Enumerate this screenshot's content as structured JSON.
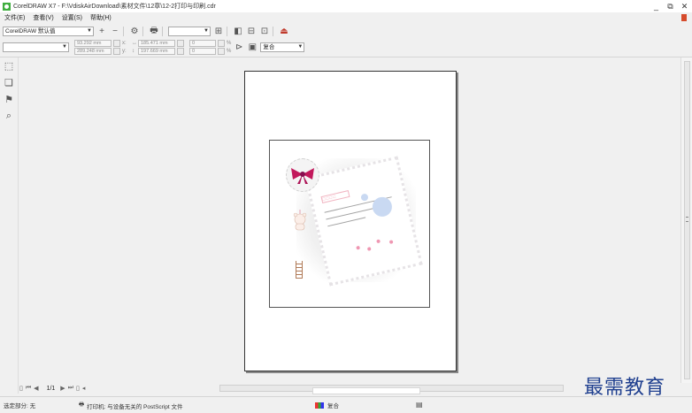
{
  "window": {
    "title": "CorelDRAW X7 - F:\\VdiskAirDownload\\素材文件\\12章\\12-2打印与印刷.cdr",
    "controls": [
      "_",
      "⧉",
      "✕"
    ]
  },
  "menu": [
    "文件(E)",
    "查看(V)",
    "设置(S)",
    "帮助(H)"
  ],
  "toolbar1": {
    "preset_combo": "CorelDRAW 默认值"
  },
  "toolbar2": {
    "x_value": "93.292 mm",
    "y_value": "289.248 mm",
    "x_label": "x:",
    "y_label": "y:",
    "width_value": "185.471 mm",
    "height_value": "197.669 mm",
    "scale_x": "0",
    "scale_y": "0",
    "pct": "%",
    "mode_combo": "复合"
  },
  "card": {
    "title_text": "□□□□"
  },
  "pagebar": {
    "page_indicator": "1/1"
  },
  "status": {
    "selection": "选定部分: 无",
    "printer": "打印机: 与设备无关的 PostScript 文件",
    "mode": "复合"
  },
  "watermark": "最需教育"
}
